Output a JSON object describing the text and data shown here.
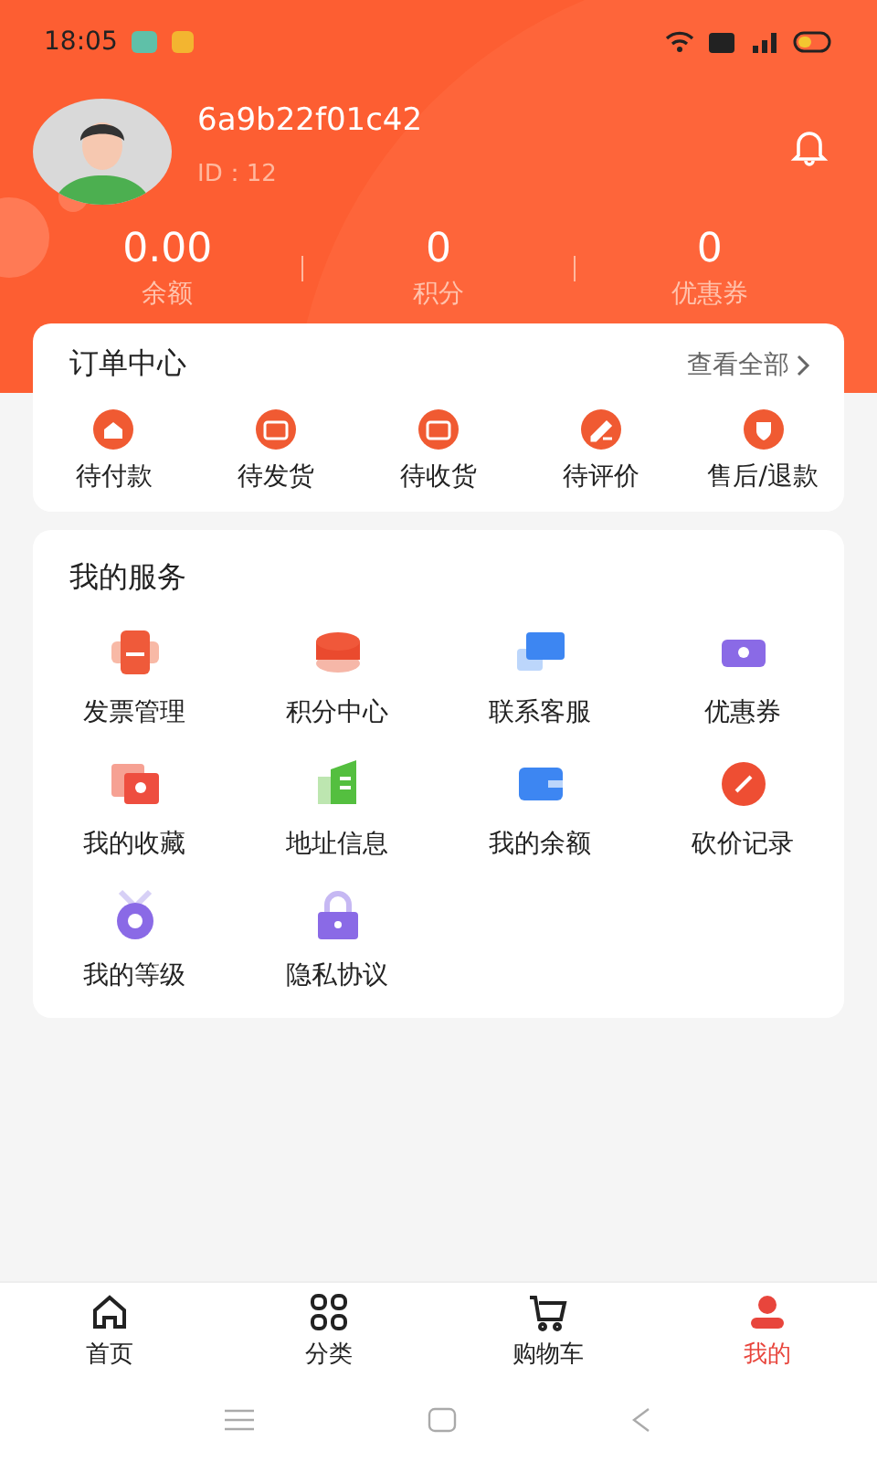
{
  "status_bar": {
    "time": "18:05"
  },
  "profile": {
    "name": "6a9b22f01c42",
    "id": "ID：12"
  },
  "stats": [
    {
      "value": "0.00",
      "label": "余额"
    },
    {
      "value": "0",
      "label": "积分"
    },
    {
      "value": "0",
      "label": "优惠券"
    }
  ],
  "orders": {
    "title": "订单中心",
    "view_all": "查看全部",
    "items": [
      "待付款",
      "待发货",
      "待收货",
      "待评价",
      "售后/退款"
    ]
  },
  "services": {
    "title": "我的服务",
    "items": [
      "发票管理",
      "积分中心",
      "联系客服",
      "优惠券",
      "我的收藏",
      "地址信息",
      "我的余额",
      "砍价记录",
      "我的等级",
      "隐私协议"
    ]
  },
  "tabs": [
    {
      "label": "首页",
      "selected": false
    },
    {
      "label": "分类",
      "selected": false
    },
    {
      "label": "购物车",
      "selected": false
    },
    {
      "label": "我的",
      "selected": true
    }
  ]
}
